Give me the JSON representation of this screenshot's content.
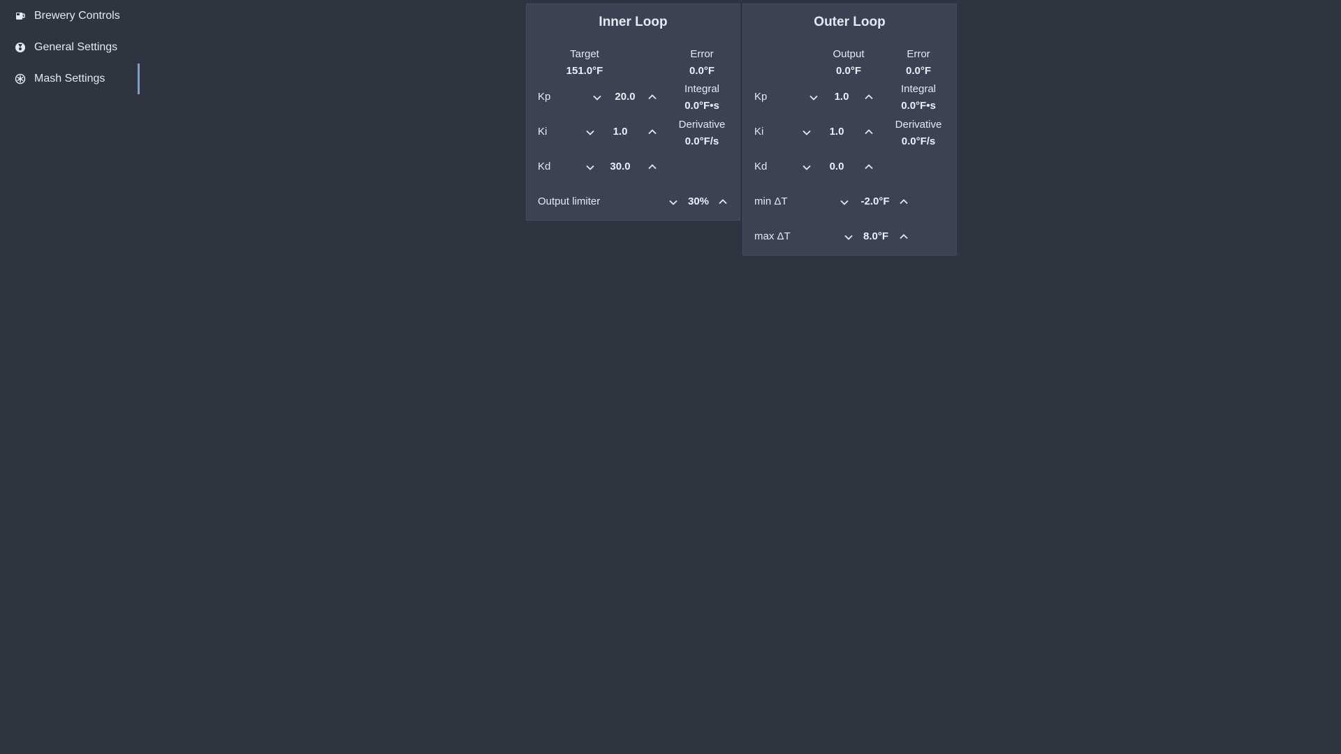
{
  "sidebar": {
    "items": [
      {
        "label": "Brewery Controls",
        "icon": "brewery-icon"
      },
      {
        "label": "General Settings",
        "icon": "settings-icon"
      },
      {
        "label": "Mash Settings",
        "icon": "mash-icon",
        "active": true
      }
    ]
  },
  "inner_loop": {
    "title": "Inner Loop",
    "target_label": "Target",
    "target_value": "151.0°F",
    "error_label": "Error",
    "error_value": "0.0°F",
    "integral_label": "Integral",
    "integral_value": "0.0°F•s",
    "derivative_label": "Derivative",
    "derivative_value": "0.0°F/s",
    "kp_label": "Kp",
    "kp_value": "20.0",
    "ki_label": "Ki",
    "ki_value": "1.0",
    "kd_label": "Kd",
    "kd_value": "30.0",
    "limiter_label": "Output limiter",
    "limiter_value": "30%"
  },
  "outer_loop": {
    "title": "Outer Loop",
    "output_label": "Output",
    "output_value": "0.0°F",
    "error_label": "Error",
    "error_value": "0.0°F",
    "integral_label": "Integral",
    "integral_value": "0.0°F•s",
    "derivative_label": "Derivative",
    "derivative_value": "0.0°F/s",
    "kp_label": "Kp",
    "kp_value": "1.0",
    "ki_label": "Ki",
    "ki_value": "1.0",
    "kd_label": "Kd",
    "kd_value": "0.0",
    "min_dt_label": "min ΔT",
    "min_dt_value": "-2.0°F",
    "max_dt_label": "max ΔT",
    "max_dt_value": "8.0°F"
  },
  "colors": {
    "background": "#2e3440",
    "panel": "#3b4252",
    "active_indicator": "#81a1c1"
  }
}
